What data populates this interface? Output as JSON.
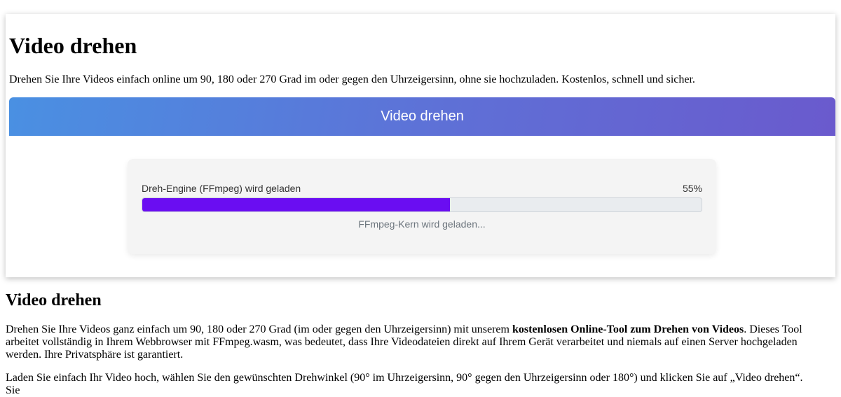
{
  "tool": {
    "title": "Video drehen",
    "intro": "Drehen Sie Ihre Videos einfach online um 90, 180 oder 270 Grad im oder gegen den Uhrzeigersinn, ohne sie hochzuladen. Kostenlos, schnell und sicher.",
    "banner_label": "Video drehen",
    "loader": {
      "label": "Dreh-Engine (FFmpeg) wird geladen",
      "percent_text": "55%",
      "progress": 55,
      "status": "FFmpeg-Kern wird geladen...",
      "fill_color": "#6a0df2"
    }
  },
  "article": {
    "heading": "Video drehen",
    "p1_start": "Drehen Sie Ihre Videos ganz einfach um 90, 180 oder 270 Grad (im oder gegen den Uhrzeigersinn) mit unserem ",
    "p1_bold": "kostenlosen Online-Tool zum Drehen von Videos",
    "p1_end": ". Dieses Tool arbeitet vollständig in Ihrem Webbrowser mit FFmpeg.wasm, was bedeutet, dass Ihre Videodateien direkt auf Ihrem Gerät verarbeitet und niemals auf einen Server hochgeladen werden. Ihre Privatsphäre ist garantiert.",
    "p2": "Laden Sie einfach Ihr Video hoch, wählen Sie den gewünschten Drehwinkel (90° im Uhrzeigersinn, 90° gegen den Uhrzeigersinn oder 180°) und klicken Sie auf „Video drehen“. Sie"
  }
}
